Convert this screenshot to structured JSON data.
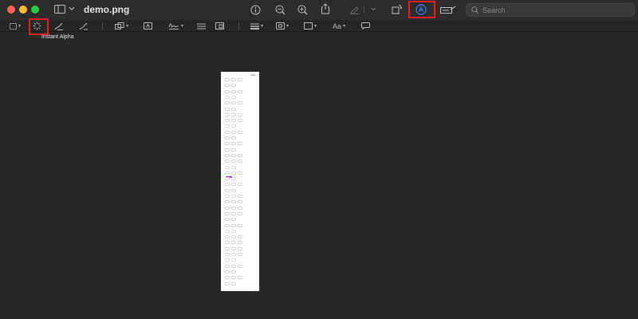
{
  "window": {
    "title": "demo.png"
  },
  "toolbar": {
    "search_placeholder": "Search",
    "icons": [
      "sidebar-icon",
      "info-icon",
      "zoom-out-icon",
      "zoom-in-icon",
      "share-icon",
      "highlight-icon",
      "rotate-icon",
      "markup-icon",
      "annotate-icon"
    ]
  },
  "markup": {
    "text_style_label": "Aa",
    "tooltip": "Instant Alpha"
  },
  "colors": {
    "highlight_box": "#e02020",
    "accent": "#3b82f6",
    "background": "#272727"
  }
}
